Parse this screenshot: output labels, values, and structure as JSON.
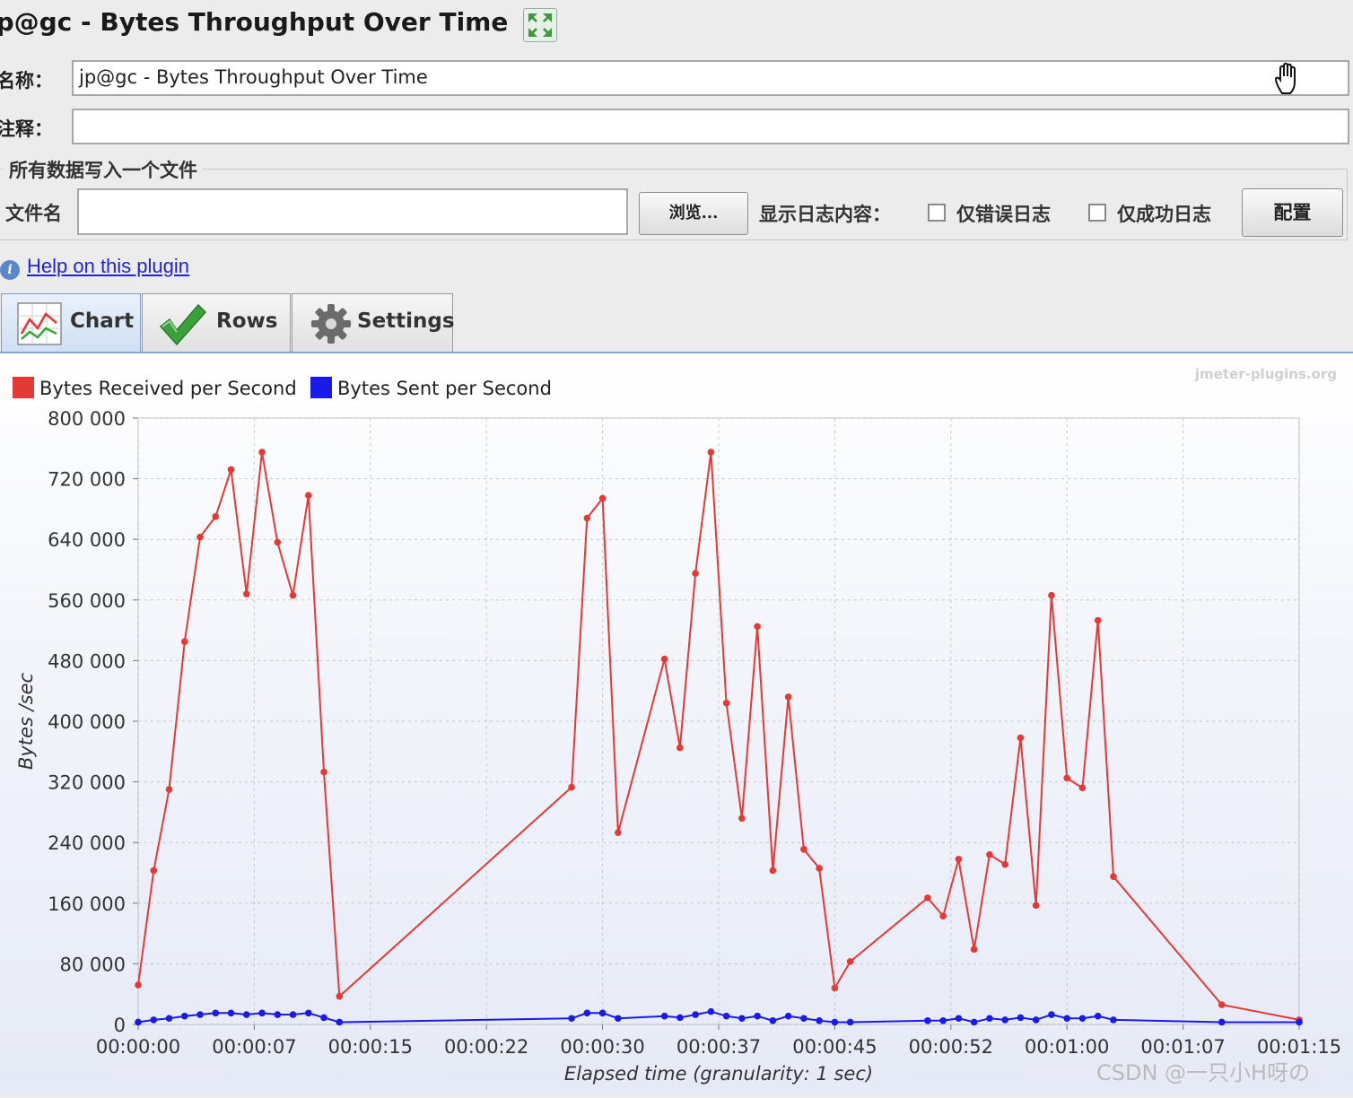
{
  "window": {
    "title": "jp@gc - Bytes Throughput Over Time"
  },
  "form": {
    "name_label": "名称：",
    "name_value": "jp@gc - Bytes Throughput Over Time",
    "comment_label": "注释：",
    "comment_value": "",
    "file_section_title": "所有数据写入一个文件",
    "filename_label": "文件名",
    "filename_value": "",
    "browse_button": "浏览...",
    "log_display_label": "显示日志内容：",
    "errors_only_label": "仅错误日志",
    "errors_only_checked": false,
    "success_only_label": "仅成功日志",
    "success_only_checked": false,
    "configure_button": "配置"
  },
  "help": {
    "link_text": "Help on this plugin",
    "icon": "info-icon"
  },
  "tabs": [
    {
      "label": "Chart",
      "icon": "chart-icon",
      "active": true
    },
    {
      "label": "Rows",
      "icon": "checkmark-icon",
      "active": false
    },
    {
      "label": "Settings",
      "icon": "gear-icon",
      "active": false
    }
  ],
  "watermark_text": "CSDN @一只小H呀の",
  "colors": {
    "received": "#e53935",
    "sent": "#1a1aeb",
    "link": "#2323d6"
  },
  "chart_data": {
    "type": "line",
    "credit": "jmeter-plugins.org",
    "xlabel": "Elapsed time (granularity: 1 sec)",
    "ylabel": "Bytes /sec",
    "legend_position": "top-left",
    "grid": true,
    "xlim": [
      0,
      75
    ],
    "ylim": [
      0,
      800000
    ],
    "x_ticks": [
      0,
      7.5,
      15,
      22.5,
      30,
      37.5,
      45,
      52.5,
      60,
      67.5,
      75
    ],
    "x_tick_labels": [
      "00:00:00",
      "00:00:07",
      "00:00:15",
      "00:00:22",
      "00:00:30",
      "00:00:37",
      "00:00:45",
      "00:00:52",
      "00:01:00",
      "00:01:07",
      "00:01:15"
    ],
    "y_ticks": [
      0,
      80000,
      160000,
      240000,
      320000,
      400000,
      480000,
      560000,
      640000,
      720000,
      800000
    ],
    "y_tick_labels": [
      "0",
      "80 000",
      "160 000",
      "240 000",
      "320 000",
      "400 000",
      "480 000",
      "560 000",
      "640 000",
      "720 000",
      "800 000"
    ],
    "series": [
      {
        "name": "Bytes Received per Second",
        "color": "#e53935",
        "points": [
          [
            0,
            52000
          ],
          [
            1,
            203000
          ],
          [
            2,
            310000
          ],
          [
            3,
            505000
          ],
          [
            4,
            643000
          ],
          [
            5,
            670000
          ],
          [
            6,
            732000
          ],
          [
            7,
            568000
          ],
          [
            8,
            755000
          ],
          [
            9,
            636000
          ],
          [
            10,
            566000
          ],
          [
            11,
            698000
          ],
          [
            12,
            333000
          ],
          [
            13,
            37000
          ],
          [
            28,
            313000
          ],
          [
            29,
            668000
          ],
          [
            30,
            694000
          ],
          [
            31,
            253000
          ],
          [
            34,
            482000
          ],
          [
            35,
            365000
          ],
          [
            36,
            595000
          ],
          [
            37,
            755000
          ],
          [
            38,
            424000
          ],
          [
            39,
            272000
          ],
          [
            40,
            525000
          ],
          [
            41,
            203000
          ],
          [
            42,
            432000
          ],
          [
            43,
            231000
          ],
          [
            44,
            206000
          ],
          [
            45,
            48000
          ],
          [
            46,
            83000
          ],
          [
            51,
            167000
          ],
          [
            52,
            143000
          ],
          [
            53,
            218000
          ],
          [
            54,
            99000
          ],
          [
            55,
            224000
          ],
          [
            56,
            211000
          ],
          [
            57,
            378000
          ],
          [
            58,
            157000
          ],
          [
            59,
            566000
          ],
          [
            60,
            325000
          ],
          [
            61,
            312000
          ],
          [
            62,
            533000
          ],
          [
            63,
            195000
          ],
          [
            70,
            26000
          ],
          [
            75,
            6000
          ]
        ]
      },
      {
        "name": "Bytes Sent per Second",
        "color": "#1a1aeb",
        "points": [
          [
            0,
            3000
          ],
          [
            1,
            6000
          ],
          [
            2,
            8000
          ],
          [
            3,
            11000
          ],
          [
            4,
            13000
          ],
          [
            5,
            15000
          ],
          [
            6,
            15000
          ],
          [
            7,
            13000
          ],
          [
            8,
            15000
          ],
          [
            9,
            13000
          ],
          [
            10,
            13000
          ],
          [
            11,
            15000
          ],
          [
            12,
            9000
          ],
          [
            13,
            3000
          ],
          [
            28,
            8000
          ],
          [
            29,
            15000
          ],
          [
            30,
            15000
          ],
          [
            31,
            8000
          ],
          [
            34,
            11000
          ],
          [
            35,
            9000
          ],
          [
            36,
            13000
          ],
          [
            37,
            17000
          ],
          [
            38,
            11000
          ],
          [
            39,
            8000
          ],
          [
            40,
            11000
          ],
          [
            41,
            5000
          ],
          [
            42,
            11000
          ],
          [
            43,
            8000
          ],
          [
            44,
            5000
          ],
          [
            45,
            3000
          ],
          [
            46,
            3000
          ],
          [
            51,
            5000
          ],
          [
            52,
            5000
          ],
          [
            53,
            8000
          ],
          [
            54,
            3000
          ],
          [
            55,
            8000
          ],
          [
            56,
            6000
          ],
          [
            57,
            9000
          ],
          [
            58,
            6000
          ],
          [
            59,
            13000
          ],
          [
            60,
            8000
          ],
          [
            61,
            8000
          ],
          [
            62,
            11000
          ],
          [
            63,
            6000
          ],
          [
            70,
            3000
          ],
          [
            75,
            3000
          ]
        ]
      }
    ]
  }
}
